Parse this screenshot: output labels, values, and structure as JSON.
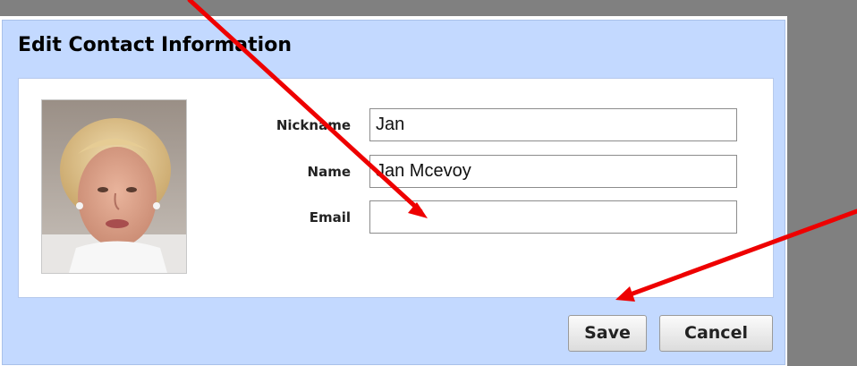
{
  "dialog": {
    "title": "Edit Contact Information"
  },
  "contact": {
    "photo_alt": "contact photo",
    "fields": {
      "nickname": {
        "label": "Nickname",
        "value": "Jan"
      },
      "name": {
        "label": "Name",
        "value": "Jan Mcevoy"
      },
      "email": {
        "label": "Email",
        "value": ""
      }
    }
  },
  "buttons": {
    "save_label": "Save",
    "cancel_label": "Cancel"
  },
  "colors": {
    "dialog_background": "#c3d9ff",
    "annotation_arrow": "#ee0000",
    "backdrop": "#808080"
  }
}
